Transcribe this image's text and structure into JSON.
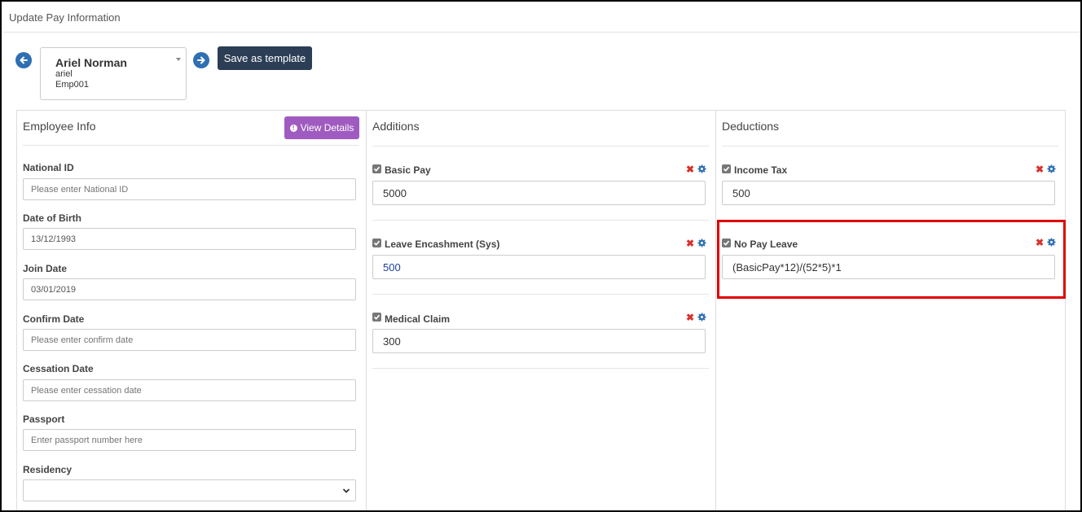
{
  "header": {
    "title": "Update Pay Information"
  },
  "employee": {
    "name": "Ariel Norman",
    "username": "ariel",
    "code": "Emp001"
  },
  "toolbar": {
    "save_template": "Save as template"
  },
  "employee_info": {
    "title": "Employee Info",
    "view_details": "View Details",
    "fields": [
      {
        "label": "National ID",
        "value": "",
        "placeholder": "Please enter National ID"
      },
      {
        "label": "Date of Birth",
        "value": "13/12/1993",
        "placeholder": ""
      },
      {
        "label": "Join Date",
        "value": "03/01/2019",
        "placeholder": ""
      },
      {
        "label": "Confirm Date",
        "value": "",
        "placeholder": "Please enter confirm date"
      },
      {
        "label": "Cessation Date",
        "value": "",
        "placeholder": "Please enter cessation date"
      },
      {
        "label": "Passport",
        "value": "",
        "placeholder": "Enter passport number here"
      },
      {
        "label": "Residency",
        "value": "",
        "placeholder": ""
      }
    ]
  },
  "additions": {
    "title": "Additions",
    "items": [
      {
        "label": "Basic Pay",
        "value": "5000"
      },
      {
        "label": "Leave Encashment (Sys)",
        "value": "500"
      },
      {
        "label": "Medical Claim",
        "value": "300"
      }
    ]
  },
  "deductions": {
    "title": "Deductions",
    "items": [
      {
        "label": "Income Tax",
        "value": "500"
      },
      {
        "label": "No Pay Leave",
        "value": "(BasicPay*12)/(52*5)*1"
      }
    ]
  },
  "colors": {
    "primary_dark": "#2c3e55",
    "purple": "#a05bc0",
    "nav_blue": "#2f6fb3",
    "remove_red": "#d9312b",
    "highlight": "#e00000"
  }
}
